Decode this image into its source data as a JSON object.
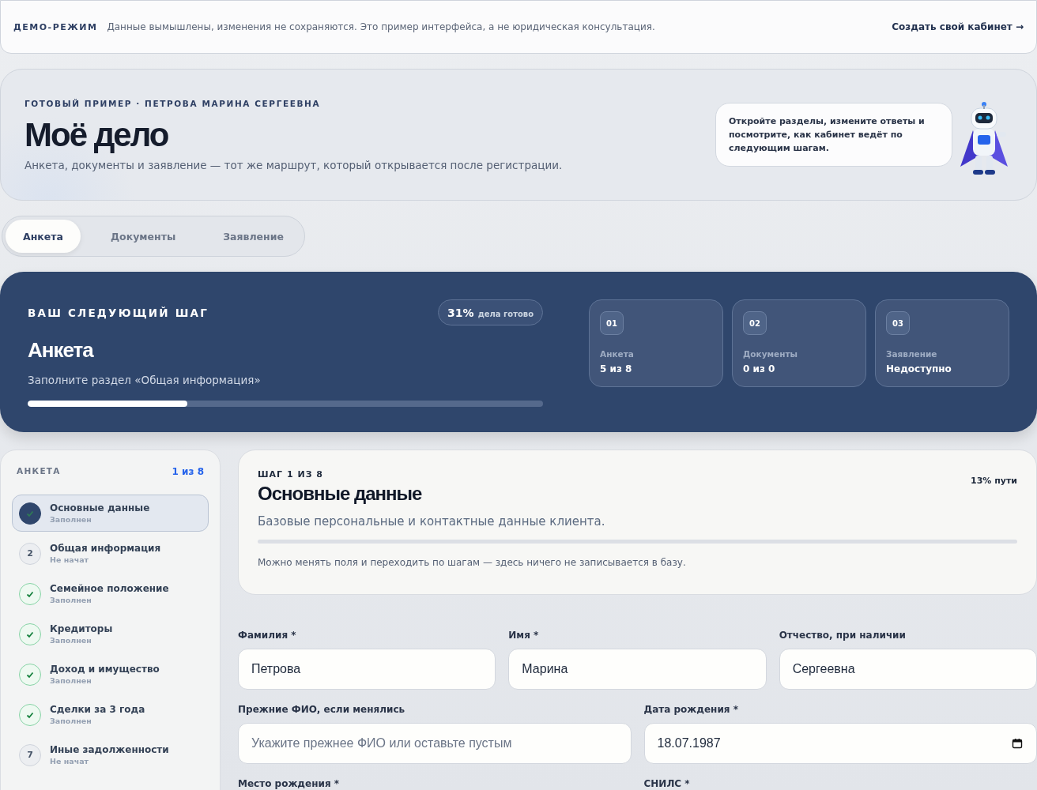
{
  "demo_bar": {
    "badge": "ДЕМО-РЕЖИМ",
    "text": "Данные вымышлены, изменения не сохраняются. Это пример интерфейса, а не юридическая консультация.",
    "link": "Создать свой кабинет →"
  },
  "hero": {
    "eyebrow": "ГОТОВЫЙ ПРИМЕР · ПЕТРОВА МАРИНА СЕРГЕЕВНА",
    "title": "Моё дело",
    "subtitle": "Анкета, документы и заявление — тот же маршрут, который открывается после регистрации.",
    "tip": "Откройте разделы, измените ответы и посмотрите, как кабинет ведёт по следующим шагам."
  },
  "tabs": [
    {
      "label": "Анкета",
      "selected": true
    },
    {
      "label": "Документы",
      "selected": false
    },
    {
      "label": "Заявление",
      "selected": false
    }
  ],
  "next_step": {
    "eyebrow": "ВАШ СЛЕДУЮЩИЙ ШАГ",
    "title": "Анкета",
    "text": "Заполните раздел «Общая информация»",
    "percent": "31%",
    "percent_label": "дела готово",
    "level": 0.31,
    "stages": [
      {
        "number": "01",
        "name": "Анкета",
        "value": "5 из 8"
      },
      {
        "number": "02",
        "name": "Документы",
        "value": "0 из 0"
      },
      {
        "number": "03",
        "name": "Заявление",
        "value": "Недоступно"
      }
    ]
  },
  "sidebar": {
    "title": "АНКЕТА",
    "counter": "1 из 8",
    "items": [
      {
        "title": "Основные данные",
        "status": "Заполнен",
        "done": true,
        "selected": true
      },
      {
        "number": "2",
        "title": "Общая информация",
        "status": "Не начат",
        "done": false,
        "selected": false
      },
      {
        "title": "Семейное положение",
        "status": "Заполнен",
        "done": true,
        "selected": false
      },
      {
        "title": "Кредиторы",
        "status": "Заполнен",
        "done": true,
        "selected": false
      },
      {
        "title": "Доход и имущество",
        "status": "Заполнен",
        "done": true,
        "selected": false
      },
      {
        "title": "Сделки за 3 года",
        "status": "Заполнен",
        "done": true,
        "selected": false
      },
      {
        "number": "7",
        "title": "Иные задолженности",
        "status": "Не начат",
        "done": false,
        "selected": false
      }
    ]
  },
  "step": {
    "eyebrow": "ШАГ 1 ИЗ 8",
    "progress": "13% пути",
    "title": "Основные данные",
    "subtitle": "Базовые персональные и контактные данные клиента.",
    "note": "Можно менять поля и переходить по шагам — здесь ничего не записывается в базу."
  },
  "form_rows": [
    [
      {
        "label": "Фамилия *",
        "value": "Петрова",
        "kind": "text"
      },
      {
        "label": "Имя *",
        "value": "Марина",
        "kind": "text"
      },
      {
        "label": "Отчество, при наличии",
        "value": "Сергеевна",
        "kind": "text"
      }
    ],
    [
      {
        "label": "Прежние ФИО, если менялись",
        "placeholder": "Укажите прежнее ФИО или оставьте пустым",
        "kind": "text"
      },
      {
        "label": "Дата рождения *",
        "value": "18.07.1987",
        "kind": "date"
      }
    ],
    [
      {
        "label": "Место рождения *"
      },
      {
        "label": "СНИЛС *"
      }
    ]
  ]
}
